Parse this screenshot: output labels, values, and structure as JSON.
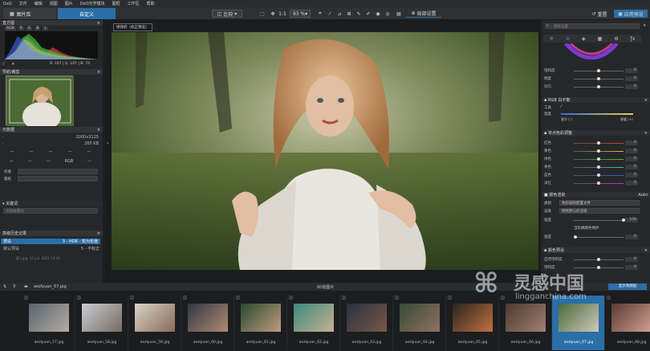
{
  "menu": [
    "DxO",
    "文件",
    "编辑",
    "视图",
    "图片",
    "DxO光学模块",
    "图框",
    "工作区",
    "帮助"
  ],
  "toolbar": {
    "tab_library": "图片库",
    "tab_custom": "自定义",
    "compare": "比较",
    "zoom_ratio": "1:1",
    "zoom_value": "93 %",
    "local_adjust": "局部设置",
    "reset": "重置",
    "apply_preset": "应用预设"
  },
  "left_panel": {
    "histogram_title": "直方图",
    "histogram_channels": [
      "RGB",
      "R",
      "G",
      "B",
      "L"
    ],
    "rgb_readout": "R: 107 | G: 107 | B: 74",
    "nav_title": "导航/裁剪",
    "metadata_title": "元数据",
    "dimensions": "2000x3125",
    "filesize": "265 KB",
    "color_mode": "RGB",
    "author_label": "作者",
    "copyright_label": "版权",
    "keywords_title": "关键词",
    "keywords_placeholder": "添加关键词",
    "history_title": "高级历史记录",
    "history": [
      {
        "name": "预设",
        "detail": "3 - HDR - 较为松弛",
        "active": true
      },
      {
        "name": "默认预设",
        "detail": "5 - 不标正",
        "active": false
      }
    ],
    "history_note": "载入jpg: 15 juil. 2021 14:19"
  },
  "preview_note": "修改的（校正预览）",
  "right_panel": {
    "search_placeholder": "搜索设置",
    "top_sliders": [
      {
        "label": "饱和度",
        "value": "0",
        "pos": 0.5
      },
      {
        "label": "明度",
        "value": "0",
        "pos": 0.5
      },
      {
        "label": "均匀",
        "value": "0",
        "pos": 0.5
      }
    ],
    "wb_title": "RGB 白平衡",
    "wb_tool": "工具",
    "wb_temp": "温度",
    "wb_cooler": "更冷 (-)",
    "wb_warmer": "更暖 (+)",
    "hsl_title": "单点色彩调整",
    "hsl_channels": [
      {
        "label": "红色",
        "value": "0",
        "color": "#d23a3a"
      },
      {
        "label": "黄色",
        "value": "0",
        "color": "#d2c23a"
      },
      {
        "label": "绿色",
        "value": "0",
        "color": "#3ac23a"
      },
      {
        "label": "青色",
        "value": "0",
        "color": "#3ab8c2"
      },
      {
        "label": "蓝色",
        "value": "0",
        "color": "#3a5ad2"
      },
      {
        "label": "洋红",
        "value": "0",
        "color": "#c23ab8"
      }
    ],
    "render_title": "颜色渲染",
    "render_auto": "Auto",
    "render_category_label": "类别",
    "render_category": "色彩描绘配置文件",
    "render_type_label": "渲染",
    "render_type": "明亮默认的渲染",
    "render_strength_label": "强度",
    "render_strength": "100",
    "protect_label": "当轮廓颜色保护",
    "intensity_label": "强度",
    "intensity_value": "0",
    "preset_title": "颜色预设",
    "bottom_sliders": [
      {
        "label": "自然饱和度",
        "value": "0",
        "pos": 0.5
      },
      {
        "label": "饱和度",
        "value": "0",
        "pos": 0.5
      }
    ]
  },
  "filmstrip": {
    "folder": "aezlyuan_67.jpg",
    "count_label": "60张图片",
    "view_label": "显示到图层",
    "items": [
      {
        "name": "aezlyuan_57.jpg",
        "selected": false,
        "c1": "#5a6470",
        "c2": "#b4aca0"
      },
      {
        "name": "aezlyuan_58.jpg",
        "selected": false,
        "c1": "#c8cdd2",
        "c2": "#7a6a60"
      },
      {
        "name": "aezlyuan_59.jpg",
        "selected": false,
        "c1": "#d8d2c8",
        "c2": "#8a6a58"
      },
      {
        "name": "aezlyuan_60.jpg",
        "selected": false,
        "c1": "#303844",
        "c2": "#b08a70"
      },
      {
        "name": "aezlyuan_61.jpg",
        "selected": false,
        "c1": "#2a4a2e",
        "c2": "#c09a80"
      },
      {
        "name": "aezlyuan_62.jpg",
        "selected": false,
        "c1": "#3a8a80",
        "c2": "#c8b090"
      },
      {
        "name": "aezlyuan_63.jpg",
        "selected": false,
        "c1": "#283040",
        "c2": "#7a5848"
      },
      {
        "name": "aezlyuan_64.jpg",
        "selected": false,
        "c1": "#3a4a38",
        "c2": "#907060"
      },
      {
        "name": "aezlyuan_65.jpg",
        "selected": false,
        "c1": "#2a2420",
        "c2": "#c07040"
      },
      {
        "name": "aezlyuan_66.jpg",
        "selected": false,
        "c1": "#4a3a30",
        "c2": "#a08070"
      },
      {
        "name": "aezlyuan_67.jpg",
        "selected": true,
        "c1": "#4a6a3a",
        "c2": "#d0c8bc"
      },
      {
        "name": "aezlyuan_68.jpg",
        "selected": false,
        "c1": "#5a3a30",
        "c2": "#d0a090"
      }
    ]
  },
  "watermark": {
    "title": "灵感中国",
    "url": "lingganchina.com"
  },
  "colors": {
    "accent": "#2a6fa8",
    "panel": "#262729",
    "header": "#333436"
  }
}
